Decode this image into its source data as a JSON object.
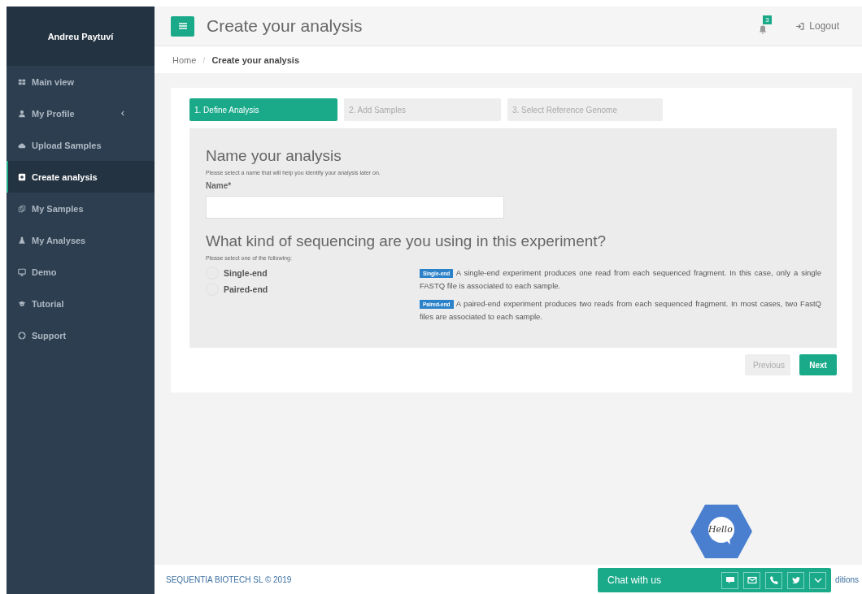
{
  "sidebar": {
    "user_name": "Andreu Paytuví",
    "items": [
      {
        "label": "Main view",
        "kind": "grid",
        "selected": false,
        "has_submenu": false
      },
      {
        "label": "My Profile",
        "kind": "user",
        "selected": false,
        "has_submenu": true
      },
      {
        "label": "Upload Samples",
        "kind": "cloud",
        "selected": false,
        "has_submenu": false
      },
      {
        "label": "Create analysis",
        "kind": "plus",
        "selected": true,
        "has_submenu": false
      },
      {
        "label": "My Samples",
        "kind": "copy",
        "selected": false,
        "has_submenu": false
      },
      {
        "label": "My Analyses",
        "kind": "flask",
        "selected": false,
        "has_submenu": false
      },
      {
        "label": "Demo",
        "kind": "monitor",
        "selected": false,
        "has_submenu": false
      },
      {
        "label": "Tutorial",
        "kind": "cap",
        "selected": false,
        "has_submenu": false
      },
      {
        "label": "Support",
        "kind": "lifebuoy",
        "selected": false,
        "has_submenu": false
      }
    ]
  },
  "header": {
    "title": "Create your analysis",
    "notifications": "3",
    "logout": "Logout"
  },
  "breadcrumb": [
    {
      "label": "Home",
      "current": false
    },
    {
      "separator": "/",
      "label": "Create your analysis",
      "current": true
    }
  ],
  "steps": [
    {
      "label": "1. Define Analysis",
      "selected": true
    },
    {
      "label": "2. Add Samples",
      "selected": false
    },
    {
      "label": "3. Select Reference Genome",
      "selected": false
    }
  ],
  "name_section": {
    "heading": "Name your analysis",
    "help": "Please select a name that will help you identify your analysis later on.",
    "label": "Name*"
  },
  "sequencing_section": {
    "heading": "What kind of sequencing are you using in this experiment?",
    "help": "Please select one of the following:",
    "options": [
      {
        "label": "Single-end",
        "selected": false
      },
      {
        "label": "Paired-end",
        "selected": false
      }
    ],
    "descriptions": [
      {
        "badge": "Single-end",
        "text": "A single-end experiment produces one read from each sequenced fragment. In this case, only a single FASTQ file is associated to each sample."
      },
      {
        "badge": "Paired-end",
        "text": "A paired-end experiment produces two reads from each sequenced fragment. In most cases, two FastQ files are associated to each sample."
      }
    ]
  },
  "buttons": [
    {
      "label": "Previous",
      "disabled": true
    },
    {
      "label": "Next",
      "disabled": false
    }
  ],
  "footer": {
    "copyright": "SEQUENTIA BIOTECH SL © 2019",
    "link": "ditions"
  },
  "hello_badge": "Hello",
  "chat": {
    "label": "Chat with us",
    "actions": [
      {
        "kind": "chat"
      },
      {
        "kind": "mail"
      },
      {
        "kind": "phone"
      },
      {
        "kind": "bird"
      },
      {
        "kind": "chevron"
      }
    ]
  }
}
